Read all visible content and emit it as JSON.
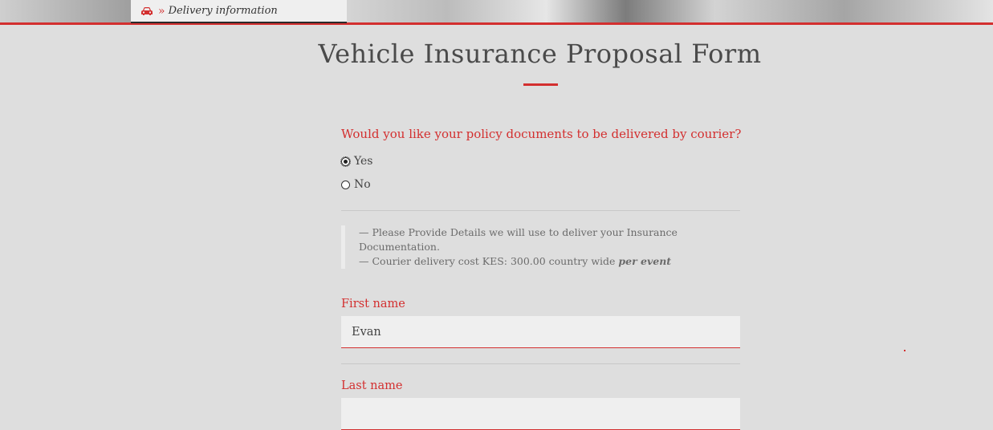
{
  "breadcrumb": {
    "icon": "car-icon",
    "chevron": "»",
    "label": "Delivery information"
  },
  "form": {
    "title": "Vehicle Insurance Proposal Form",
    "question": "Would you like your policy documents to be delivered by courier?",
    "options": [
      {
        "label": "Yes",
        "checked": true
      },
      {
        "label": "No",
        "checked": false
      }
    ],
    "note": {
      "line1": "— Please Provide Details we will use to deliver your Insurance Documentation.",
      "line2_prefix": "— Courier delivery cost KES: 300.00 country wide ",
      "line2_bold": "per event"
    },
    "first_name": {
      "label": "First name",
      "value": "Evan"
    },
    "last_name": {
      "label": "Last name",
      "value": ""
    }
  },
  "colors": {
    "accent": "#d32f2f",
    "background": "#dedede",
    "input_bg": "#efefef"
  }
}
